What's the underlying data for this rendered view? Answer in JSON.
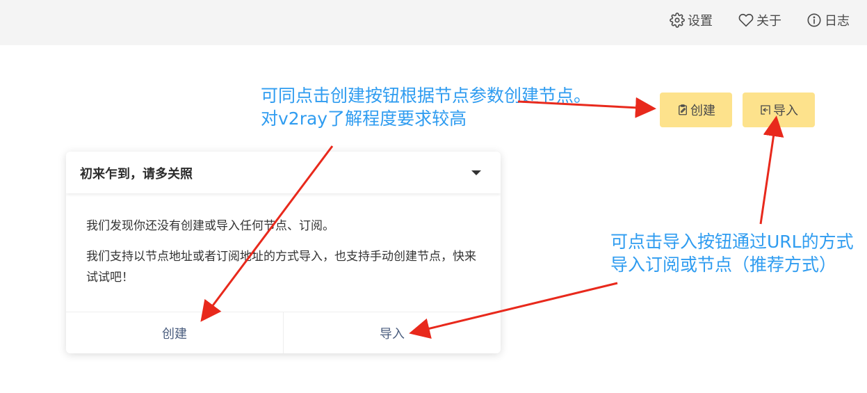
{
  "nav": {
    "settings": "设置",
    "about": "关于",
    "log": "日志",
    "settings_icon": "gear-icon",
    "about_icon": "heart-icon",
    "log_icon": "info-icon"
  },
  "actions": {
    "create_label": "创建",
    "import_label": "导入",
    "create_icon": "clipboard-edit-icon",
    "import_icon": "import-icon"
  },
  "card": {
    "title": "初来乍到，请多关照",
    "para1": "我们发现你还没有创建或导入任何节点、订阅。",
    "para2": "我们支持以节点地址或者订阅地址的方式导入，也支持手动创建节点，快来试试吧！",
    "create_label": "创建",
    "import_label": "导入"
  },
  "annotations": {
    "top_line1": "可同点击创建按钮根据节点参数创建节点。",
    "top_line2": "对v2ray了解程度要求较高",
    "right_line1": "可点击导入按钮通过URL的方式",
    "right_line2": "导入订阅或节点（推荐方式）"
  },
  "colors": {
    "action_button": "#fde28c",
    "annotation_text": "#2f9cf0",
    "arrow": "#e8291c",
    "topbar": "#f4f4f4"
  }
}
